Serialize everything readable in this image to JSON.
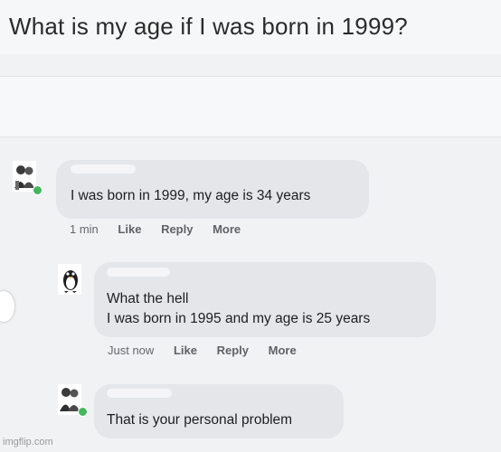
{
  "question": {
    "text": "What is my age if I was born in 1999?"
  },
  "comments": [
    {
      "text": "I was born in 1999, my age is 34 years",
      "time": "1 min",
      "actions": [
        "Like",
        "Reply",
        "More"
      ]
    },
    {
      "text_lines": [
        "What the hell",
        "I was born in 1995 and my age is 25 years"
      ],
      "time": "Just now",
      "actions": [
        "Like",
        "Reply",
        "More"
      ]
    },
    {
      "text": "That is your personal problem"
    }
  ],
  "watermark": "imgflip.com",
  "colors": {
    "bubble": "#e4e6ea",
    "online": "#44b75c",
    "action_text": "#65676b"
  }
}
